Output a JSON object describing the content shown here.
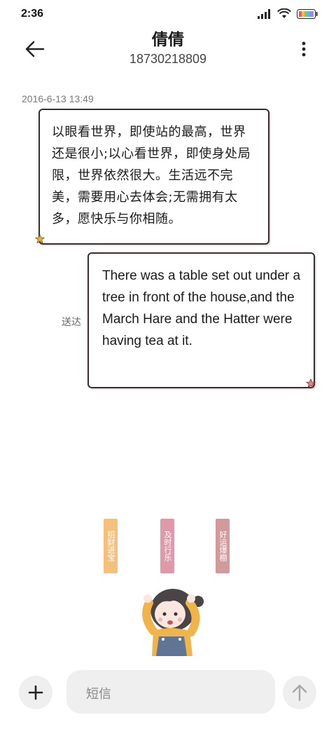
{
  "status_bar": {
    "time": "2:36",
    "icons": [
      "signal-icon",
      "wifi-icon",
      "battery-icon"
    ]
  },
  "header": {
    "contact_name": "倩倩",
    "contact_number": "18730218809",
    "back_icon": "arrow-left-icon",
    "more_icon": "more-vertical-icon"
  },
  "conversation": {
    "timestamp": "2016-6-13 13:49",
    "messages": [
      {
        "direction": "incoming",
        "text": "以眼看世界，即使站的最高，世界还是很小;以心看世界，即使身处局限，世界依然很大。生活远不完美，需要用心去体会;无需拥有太多，愿快乐与你相随。"
      },
      {
        "direction": "outgoing",
        "text": "There was a table set out under a tree in front of the house,and the March Hare and the Hatter were having tea at it.",
        "status": "送达"
      }
    ]
  },
  "sticker": {
    "banners": [
      "招财进宝",
      "及时行乐",
      "好运爆棚"
    ],
    "banner_colors": [
      "#f3b766",
      "#d9899a",
      "#c98a8a"
    ]
  },
  "input_bar": {
    "placeholder": "短信",
    "add_icon": "plus-icon",
    "send_icon": "arrow-up-icon"
  },
  "colors": {
    "bubble_border": "#3a2d2d",
    "star": "#f1b23a",
    "star_out": "#f07f8a",
    "input_bg": "#efefef"
  }
}
